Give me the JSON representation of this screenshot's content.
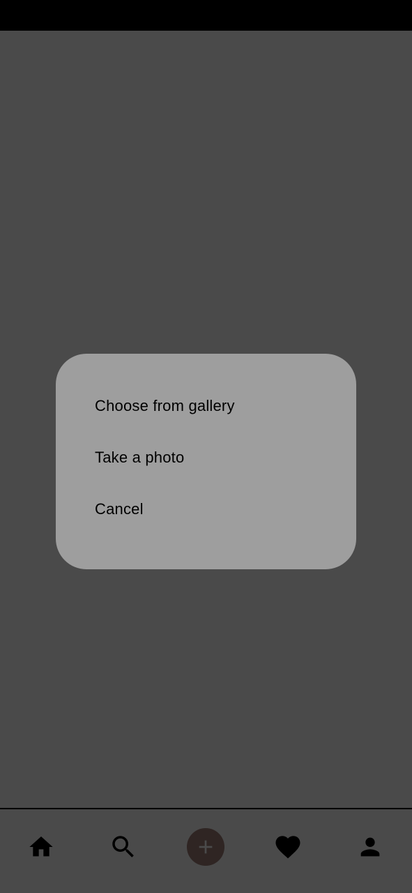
{
  "dialog": {
    "options": [
      {
        "label": "Choose from gallery"
      },
      {
        "label": "Take a photo"
      },
      {
        "label": "Cancel"
      }
    ]
  },
  "bottom_nav": {
    "items": [
      {
        "icon": "home-icon"
      },
      {
        "icon": "search-icon"
      },
      {
        "icon": "add-icon"
      },
      {
        "icon": "heart-icon"
      },
      {
        "icon": "profile-icon"
      }
    ]
  },
  "colors": {
    "background": "#4a4a4a",
    "status_bar": "#000000",
    "dialog_background": "#9e9e9e",
    "add_button": "#2f2523",
    "icon": "#000000"
  }
}
